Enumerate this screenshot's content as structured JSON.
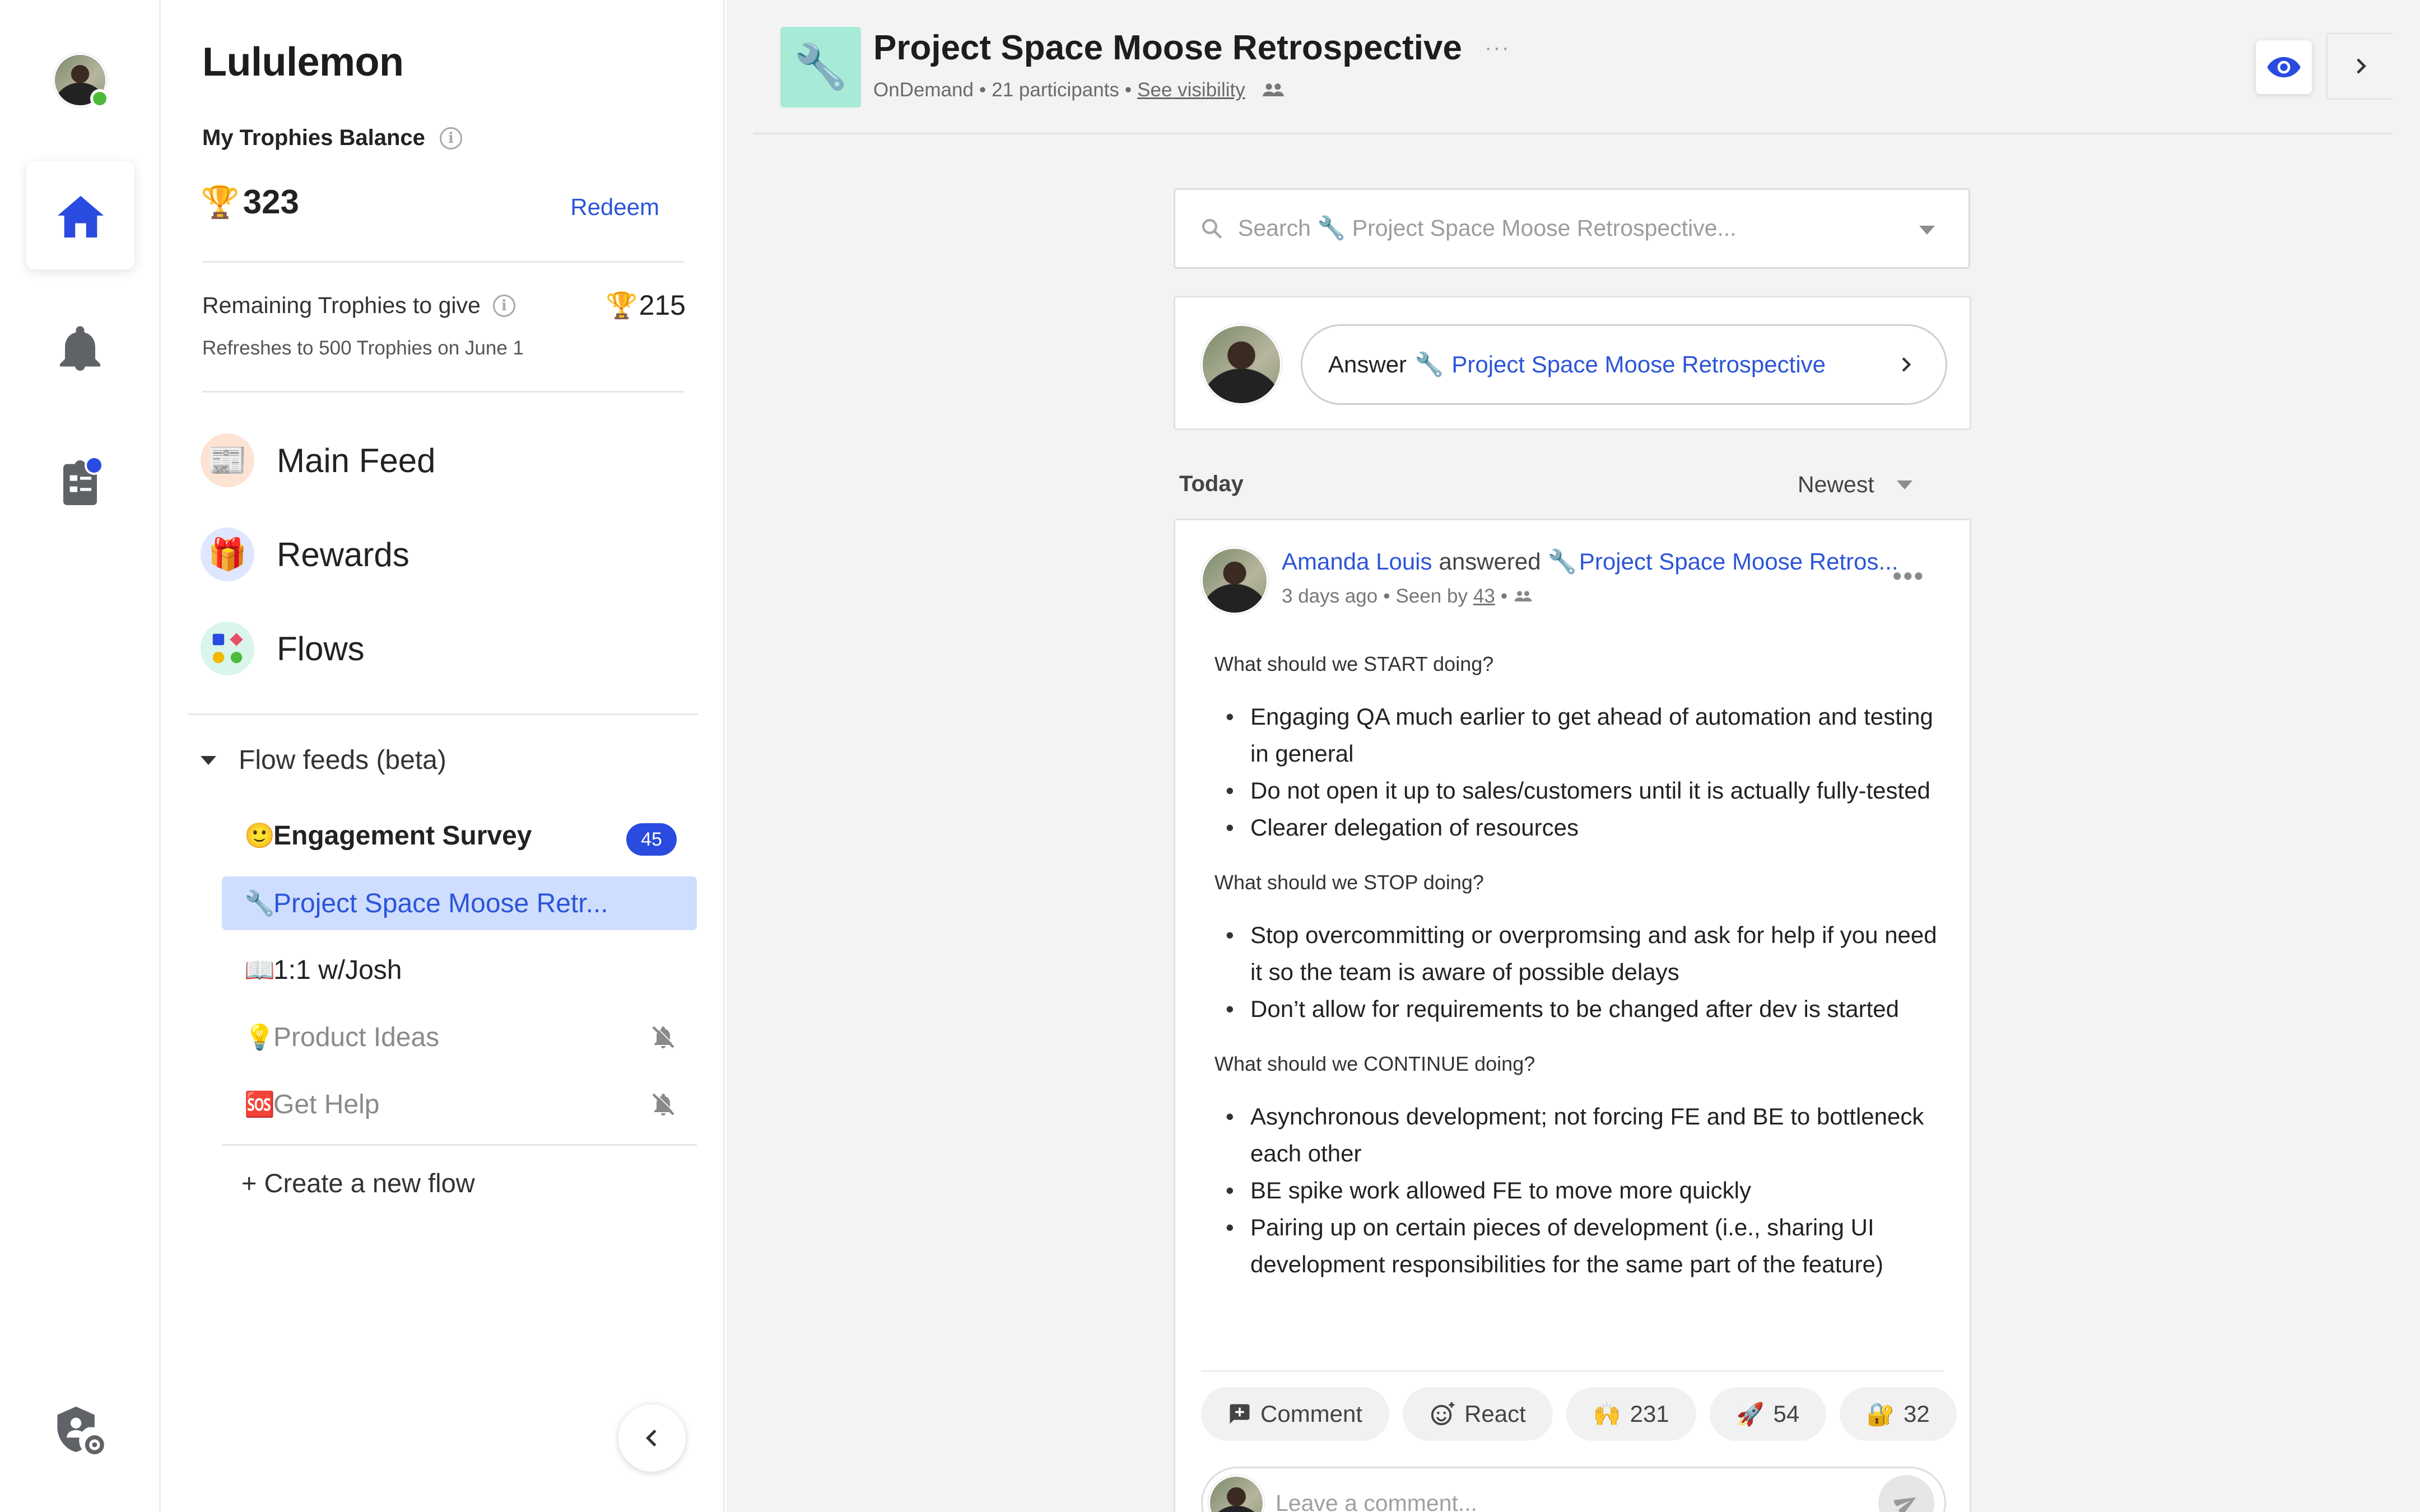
{
  "colors": {
    "accent": "#2c55d8",
    "active_flow_bg": "#cfddff",
    "badge": "#2a4bdf",
    "online": "#4cbb3a",
    "flow_thumb_bg": "#a8ead8"
  },
  "rail": {
    "icons": [
      "user-avatar",
      "home-icon",
      "bell-icon",
      "clipboard-icon",
      "admin-settings-icon"
    ]
  },
  "sidebar": {
    "org_name": "Lululemon",
    "balance_label": "My Trophies Balance",
    "balance_value": "323",
    "redeem_label": "Redeem",
    "remaining_label": "Remaining Trophies to give",
    "remaining_value": "215",
    "refresh_note": "Refreshes to 500 Trophies on June 1",
    "nav": [
      {
        "label": "Main Feed",
        "icon": "newspaper-icon"
      },
      {
        "label": "Rewards",
        "icon": "gift-icon"
      },
      {
        "label": "Flows",
        "icon": "flows-icon"
      }
    ],
    "flow_feeds_label": "Flow feeds (beta)",
    "flows": [
      {
        "emoji": "🙂",
        "label": "Engagement Survey",
        "badge": "45"
      },
      {
        "emoji": "🔧",
        "label": "Project Space Moose Retr..."
      },
      {
        "emoji": "📖",
        "label": "1:1 w/Josh"
      },
      {
        "emoji": "💡",
        "label": "Product Ideas"
      },
      {
        "emoji": "🆘",
        "label": "Get Help"
      }
    ],
    "create_flow_label": "+ Create a new flow"
  },
  "header": {
    "emoji": "🔧",
    "title": "Project Space Moose Retrospective",
    "more": "···",
    "sub_kind": "OnDemand",
    "sub_participants": "21 participants",
    "sub_visibility": "See visibility",
    "sep": "•"
  },
  "search": {
    "placeholder": "Search 🔧 Project Space Moose Retrospective..."
  },
  "answer": {
    "prefix": "Answer",
    "emoji": "🔧",
    "flow_name": "Project Space Moose Retrospective"
  },
  "feed": {
    "section_label": "Today",
    "sort_label": "Newest"
  },
  "post": {
    "author": "Amanda Louis",
    "verb": "answered",
    "emoji": "🔧",
    "flow_name": "Project Space Moose Retros...",
    "time": "3 days ago",
    "seen_prefix": "Seen by",
    "seen_count": "43",
    "sections": [
      {
        "question": "What should we START doing?",
        "answers": [
          "Engaging QA much earlier to get ahead of automation and testing in general",
          "Do not open it up to sales/customers until it is actually fully-tested",
          "Clearer delegation of resources"
        ]
      },
      {
        "question": "What should we STOP doing?",
        "answers": [
          "Stop overcommitting or overpromsing and ask for help if you need it so the team is aware of possible delays",
          "Don’t allow for requirements to be changed after dev is started"
        ]
      },
      {
        "question": "What should we CONTINUE doing?",
        "answers": [
          "Asynchronous development; not forcing FE and BE to bottleneck each other",
          "BE spike work allowed FE to move more quickly",
          "Pairing up on certain pieces of development (i.e., sharing UI development responsibilities for the same part of the feature)"
        ]
      }
    ],
    "actions": {
      "comment": "Comment",
      "react": "React"
    },
    "reactions": [
      {
        "emoji": "🙌",
        "count": "231"
      },
      {
        "emoji": "🚀",
        "count": "54"
      },
      {
        "emoji": "🔐",
        "count": "32"
      }
    ],
    "comment_placeholder": "Leave a comment..."
  }
}
